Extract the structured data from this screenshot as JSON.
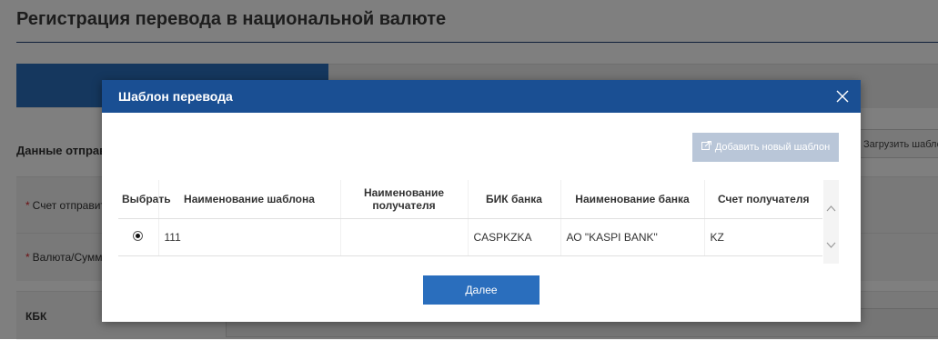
{
  "page": {
    "title": "Регистрация перевода в национальной валюте",
    "section_title": "Данные отправителя",
    "load_template_label": "Загрузить шаблон",
    "fields": [
      {
        "label": "Счет отправителя",
        "required": "*"
      },
      {
        "label": "Валюта/Сумма",
        "required": "*"
      },
      {
        "label": "КБК",
        "required": ""
      }
    ]
  },
  "modal": {
    "title": "Шаблон перевода",
    "close_icon": "close-icon",
    "add_button_label": "Добавить новый шаблон",
    "add_button_icon": "external-link-icon",
    "columns": [
      "Выбрать",
      "Наименование шаблона",
      "Наименование получателя",
      "БИК банка",
      "Наименование банка",
      "Счет получателя"
    ],
    "rows": [
      {
        "selected": true,
        "template_name": "111",
        "recipient_name": "",
        "bic": "CASPKZKA",
        "bank_name": "АО \"KASPI BANK\"",
        "account": "KZ"
      }
    ],
    "next_button_label": "Далее"
  },
  "colors": {
    "modal_header": "#1a4f93",
    "primary_button": "#2a6ebd",
    "disabled_button": "#b9c6d8",
    "required_mark": "#d9242b"
  }
}
